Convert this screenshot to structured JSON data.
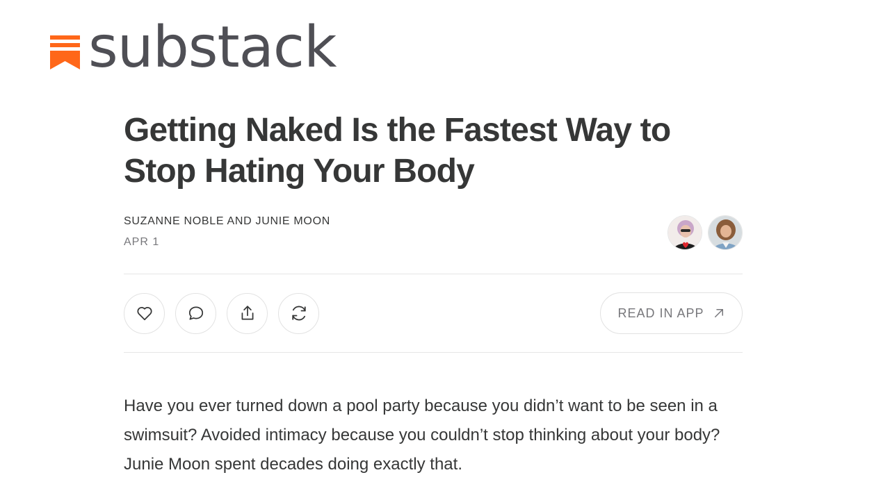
{
  "brand": {
    "name": "substack",
    "accent_color": "#ff6719",
    "logo_icon": "substack-bookmark-icon"
  },
  "post": {
    "title": "Getting Naked Is the Fastest Way to Stop Hating Your Body",
    "authors": "SUZANNE NOBLE AND JUNIE MOON",
    "date": "APR 1",
    "avatars": [
      "author-avatar-suzanne-noble",
      "author-avatar-junie-moon"
    ]
  },
  "actions": {
    "like_icon": "heart-icon",
    "comment_icon": "comment-icon",
    "share_icon": "share-icon",
    "restack_icon": "restack-icon",
    "read_in_app_label": "READ IN APP",
    "read_in_app_icon": "arrow-up-right-icon"
  },
  "body": {
    "paragraph": "Have you ever turned down a pool party because you didn’t want to be seen in a swimsuit? Avoided intimacy because you couldn’t stop thinking about your body? Junie Moon spent decades doing exactly that."
  }
}
